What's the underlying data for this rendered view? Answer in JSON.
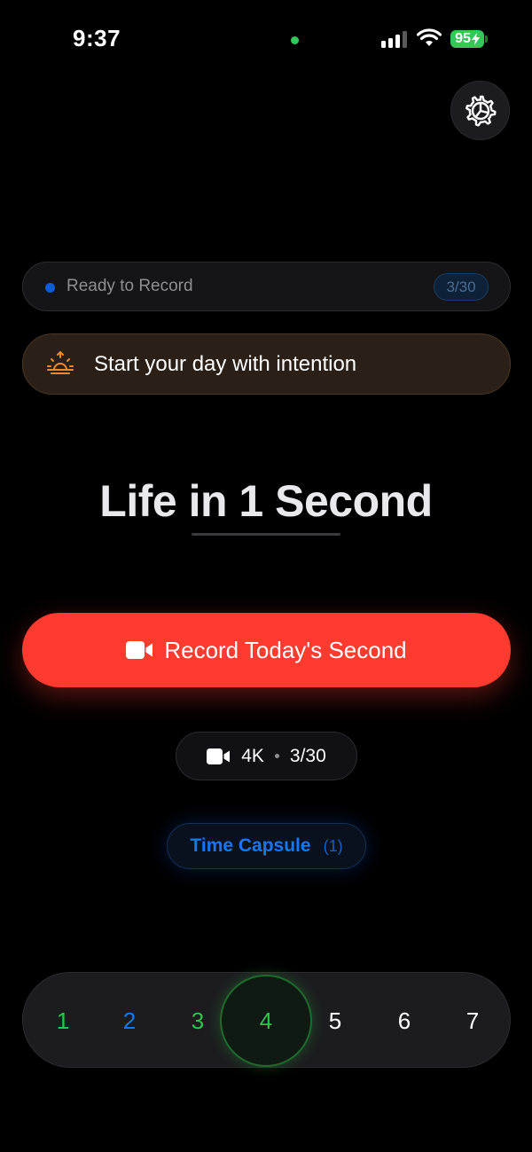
{
  "status_bar": {
    "time": "9:37",
    "battery_level": "95",
    "battery_color": "#34c759",
    "icons": [
      "signal-icon",
      "wifi-icon",
      "battery-icon"
    ]
  },
  "header": {
    "settings_icon": "gear-icon"
  },
  "status_pill": {
    "label": "Ready to Record",
    "count": "3/30",
    "dot_color": "#0a5bd6"
  },
  "intention": {
    "icon": "sunrise-icon",
    "text": "Start your day with intention",
    "accent": "#f08a24"
  },
  "title": {
    "text": "Life in 1 Second"
  },
  "record_button": {
    "icon": "video-camera-icon",
    "label": "Record Today's Second",
    "color": "#ff3b30"
  },
  "quality": {
    "icon": "video-camera-icon",
    "resolution": "4K",
    "count": "3/30"
  },
  "time_capsule": {
    "label": "Time Capsule",
    "count": "(1)",
    "color": "#1677f5"
  },
  "day_selector": {
    "days": [
      {
        "label": "1",
        "state": "recorded"
      },
      {
        "label": "2",
        "state": "capsule"
      },
      {
        "label": "3",
        "state": "recorded"
      },
      {
        "label": "4",
        "state": "selected"
      },
      {
        "label": "5",
        "state": "default"
      },
      {
        "label": "6",
        "state": "default"
      },
      {
        "label": "7",
        "state": "default"
      }
    ]
  }
}
